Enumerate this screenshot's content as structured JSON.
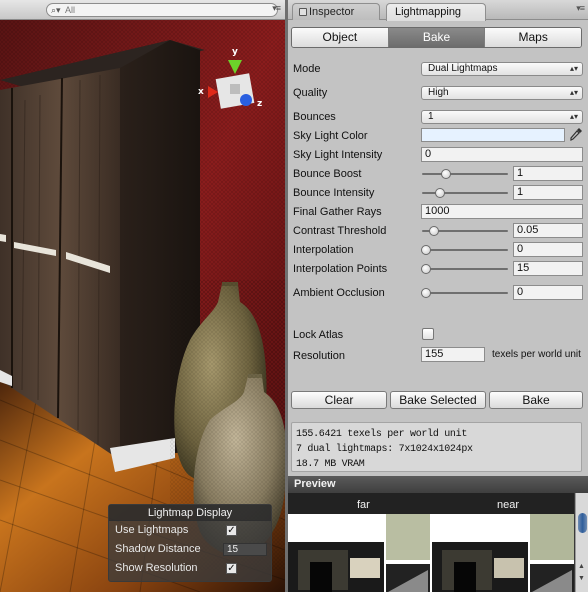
{
  "scene": {
    "search_placeholder": "All",
    "gizmo": {
      "y": "y",
      "x": "x",
      "z": "z"
    },
    "lightmap_display": {
      "title": "Lightmap Display",
      "use_lightmaps_label": "Use Lightmaps",
      "use_lightmaps_checked": "✓",
      "shadow_distance_label": "Shadow Distance",
      "shadow_distance_value": "15",
      "show_resolution_label": "Show Resolution",
      "show_resolution_checked": "✓"
    }
  },
  "tabs": {
    "inspector": "Inspector",
    "lightmapping": "Lightmapping"
  },
  "modes": {
    "object": "Object",
    "bake": "Bake",
    "maps": "Maps",
    "active": "bake"
  },
  "bake": {
    "mode_label": "Mode",
    "mode_value": "Dual Lightmaps",
    "quality_label": "Quality",
    "quality_value": "High",
    "bounces_label": "Bounces",
    "bounces_value": "1",
    "sky_light_color_label": "Sky Light Color",
    "sky_light_color": "#e6f2ff",
    "sky_light_intensity_label": "Sky Light Intensity",
    "sky_light_intensity": "0",
    "bounce_boost_label": "Bounce Boost",
    "bounce_boost": "1",
    "bounce_boost_slider": 0.25,
    "bounce_intensity_label": "Bounce Intensity",
    "bounce_intensity": "1",
    "bounce_intensity_slider": 0.18,
    "final_gather_rays_label": "Final Gather Rays",
    "final_gather_rays": "1000",
    "contrast_threshold_label": "Contrast Threshold",
    "contrast_threshold": "0.05",
    "contrast_threshold_slider": 0.1,
    "interpolation_label": "Interpolation",
    "interpolation": "0",
    "interpolation_slider": 0.0,
    "interpolation_points_label": "Interpolation Points",
    "interpolation_points": "15",
    "interpolation_points_slider": 0.0,
    "ambient_occlusion_label": "Ambient Occlusion",
    "ambient_occlusion": "0",
    "ambient_occlusion_slider": 0.0,
    "lock_atlas_label": "Lock Atlas",
    "resolution_label": "Resolution",
    "resolution": "155",
    "resolution_unit": "texels per world unit"
  },
  "buttons": {
    "clear": "Clear",
    "bake_selected": "Bake Selected",
    "bake": "Bake"
  },
  "stats": {
    "line1": "155.6421 texels per world unit",
    "line2": "7 dual lightmaps: 7x1024x1024px",
    "line3": "18.7 MB VRAM"
  },
  "preview": {
    "title": "Preview",
    "far": "far",
    "near": "near"
  }
}
